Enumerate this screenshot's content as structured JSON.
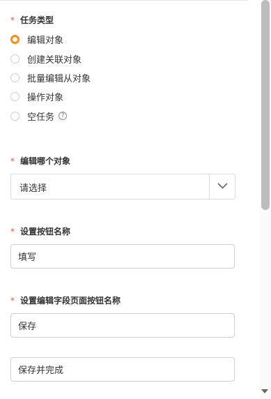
{
  "required_marker": "*",
  "task_type": {
    "label": "任务类型",
    "options": [
      {
        "label": "编辑对象",
        "checked": true
      },
      {
        "label": "创建关联对象",
        "checked": false
      },
      {
        "label": "批量编辑从对象",
        "checked": false
      },
      {
        "label": "操作对象",
        "checked": false
      },
      {
        "label": "空任务",
        "checked": false,
        "help_icon": "question-circle-icon"
      }
    ]
  },
  "edit_object": {
    "label": "编辑哪个对象",
    "value": "请选择",
    "arrow_icon": "chevron-down-icon"
  },
  "button_name": {
    "label": "设置按钮名称",
    "value": "填写"
  },
  "edit_field_page_button_name": {
    "label": "设置编辑字段页面按钮名称",
    "save_value": "保存",
    "save_complete_value": "保存并完成"
  },
  "help_glyph": "?",
  "colors": {
    "accent": "#ff8c1a",
    "required": "#f5503a",
    "border": "#dcdcdc",
    "scrollbar_thumb": "#bdbdbd"
  }
}
